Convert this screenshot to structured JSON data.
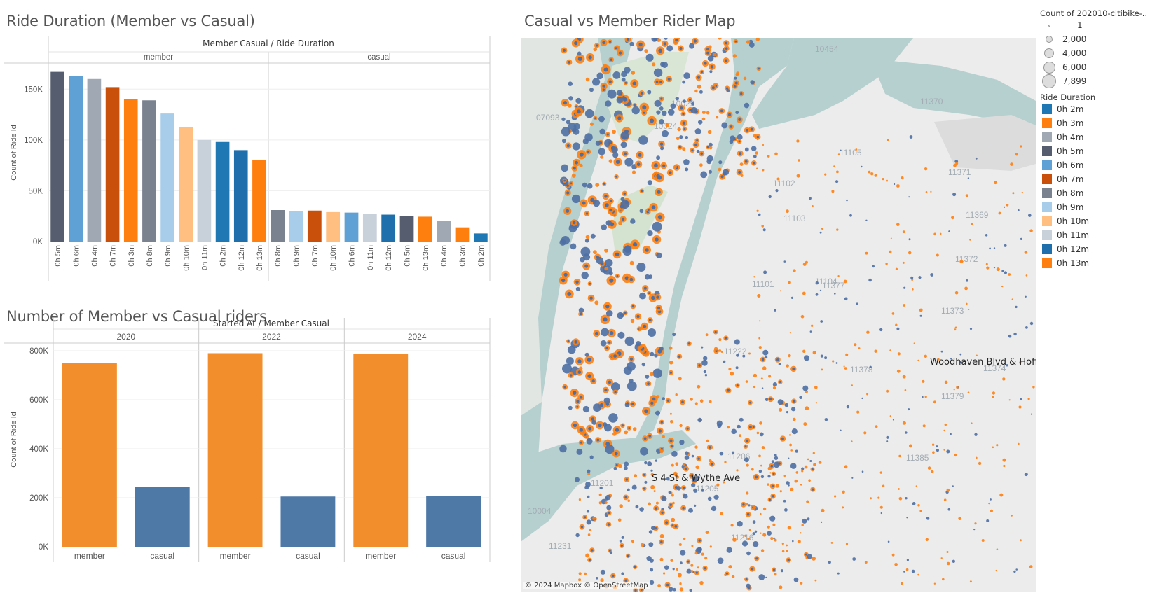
{
  "titles": {
    "ride_duration": "Ride Duration (Member vs Casual)",
    "member_vs_casual": "Number of Member vs Casual riders",
    "map": "Casual vs Member Rider Map"
  },
  "colors": {
    "0h 2m": "#1f77b4",
    "0h 3m": "#ff7f0e",
    "0h 4m": "#a0a8b3",
    "0h 5m": "#555d6e",
    "0h 6m": "#5fa1d4",
    "0h 7m": "#c9500a",
    "0h 8m": "#7a8290",
    "0h 9m": "#a7cdea",
    "0h 10m": "#ffbf80",
    "0h 11m": "#c8d0da",
    "0h 12m": "#1f6fad",
    "0h 13m": "#ff7f0e",
    "member_bar": "#f28e2b",
    "casual_bar": "#4e79a7"
  },
  "chart_data": [
    {
      "type": "bar",
      "title": "Ride Duration (Member vs Casual)",
      "header": "Member Casual  /  Ride Duration",
      "ylabel": "Count of Ride Id",
      "ylim": [
        0,
        175000
      ],
      "yticks": [
        0,
        50000,
        100000,
        150000
      ],
      "ytick_labels": [
        "0K",
        "50K",
        "100K",
        "150K"
      ],
      "panels": [
        {
          "name": "member",
          "categories": [
            "0h 5m",
            "0h 6m",
            "0h 4m",
            "0h 7m",
            "0h 3m",
            "0h 8m",
            "0h 9m",
            "0h 10m",
            "0h 11m",
            "0h 2m",
            "0h 12m",
            "0h 13m"
          ],
          "values": [
            167000,
            163000,
            160000,
            152000,
            140000,
            139000,
            126000,
            113000,
            100000,
            98000,
            90000,
            80000
          ]
        },
        {
          "name": "casual",
          "categories": [
            "0h 8m",
            "0h 9m",
            "0h 7m",
            "0h 10m",
            "0h 6m",
            "0h 11m",
            "0h 12m",
            "0h 5m",
            "0h 13m",
            "0h 4m",
            "0h 3m",
            "0h 2m"
          ],
          "values": [
            31000,
            30000,
            30500,
            29000,
            28500,
            27500,
            26500,
            25000,
            24500,
            20000,
            14000,
            8000
          ]
        }
      ]
    },
    {
      "type": "bar",
      "title": "Number of Member vs Casual riders",
      "header": "Started At  /  Member Casual",
      "ylabel": "Count of Ride Id",
      "ylim": [
        0,
        820000
      ],
      "yticks": [
        0,
        200000,
        400000,
        600000,
        800000
      ],
      "ytick_labels": [
        "0K",
        "200K",
        "400K",
        "600K",
        "800K"
      ],
      "panels": [
        {
          "name": "2020",
          "categories": [
            "member",
            "casual"
          ],
          "values": [
            750000,
            245000
          ]
        },
        {
          "name": "2022",
          "categories": [
            "member",
            "casual"
          ],
          "values": [
            790000,
            205000
          ]
        },
        {
          "name": "2024",
          "categories": [
            "member",
            "casual"
          ],
          "values": [
            787000,
            208000
          ]
        }
      ]
    }
  ],
  "map": {
    "labels": {
      "woodhaven": "Woodhaven Blvd & Hoffma",
      "s4st": "S 4 St & Wythe Ave"
    },
    "zip_labels": [
      "07093",
      "10024",
      "10029",
      "11101",
      "11105",
      "11370",
      "11371",
      "11372",
      "11373",
      "11374",
      "11379",
      "11385",
      "11222",
      "11206",
      "11205",
      "11216",
      "11231",
      "10454",
      "11102",
      "11103",
      "11104",
      "11369",
      "11378",
      "11377",
      "10004",
      "11201"
    ],
    "attribution": "© 2024 Mapbox © OpenStreetMap"
  },
  "legend": {
    "size_title": "Count of 202010-citibike-..",
    "size_items": [
      "1",
      "2,000",
      "4,000",
      "6,000",
      "7,899"
    ],
    "color_title": "Ride Duration",
    "color_items": [
      "0h 2m",
      "0h 3m",
      "0h 4m",
      "0h 5m",
      "0h 6m",
      "0h 7m",
      "0h 8m",
      "0h 9m",
      "0h 10m",
      "0h 11m",
      "0h 12m",
      "0h 13m"
    ]
  }
}
